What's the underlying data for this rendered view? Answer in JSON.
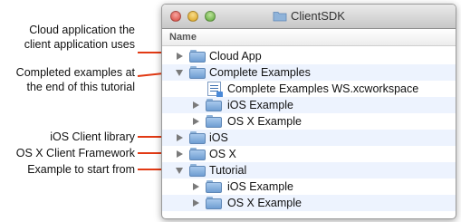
{
  "annotations": [
    {
      "lines": [
        "Cloud application the",
        "client application uses"
      ]
    },
    {
      "lines": [
        "Completed examples at",
        "the end of this tutorial"
      ]
    },
    {
      "lines": [
        "iOS Client library"
      ]
    },
    {
      "lines": [
        "OS X Client Framework"
      ]
    },
    {
      "lines": [
        "Example to start from"
      ]
    }
  ],
  "window": {
    "title": "ClientSDK",
    "column_header": "Name"
  },
  "rows": [
    {
      "label": "Cloud App",
      "icon": "folder-icon",
      "disclosure": "right"
    },
    {
      "label": "Complete Examples",
      "icon": "folder-icon",
      "disclosure": "down"
    },
    {
      "label": "Complete Examples WS.xcworkspace",
      "icon": "workspace-icon",
      "disclosure": "none"
    },
    {
      "label": "iOS Example",
      "icon": "folder-icon",
      "disclosure": "right"
    },
    {
      "label": "OS X Example",
      "icon": "folder-icon",
      "disclosure": "right"
    },
    {
      "label": "iOS",
      "icon": "folder-icon",
      "disclosure": "right"
    },
    {
      "label": "OS X",
      "icon": "folder-icon",
      "disclosure": "right"
    },
    {
      "label": "Tutorial",
      "icon": "folder-icon",
      "disclosure": "down"
    },
    {
      "label": "iOS Example",
      "icon": "folder-icon",
      "disclosure": "right"
    },
    {
      "label": "OS X Example",
      "icon": "folder-icon",
      "disclosure": "right"
    }
  ],
  "colors": {
    "arrow": "#e23a14",
    "alt_row": "#edf3fe"
  }
}
